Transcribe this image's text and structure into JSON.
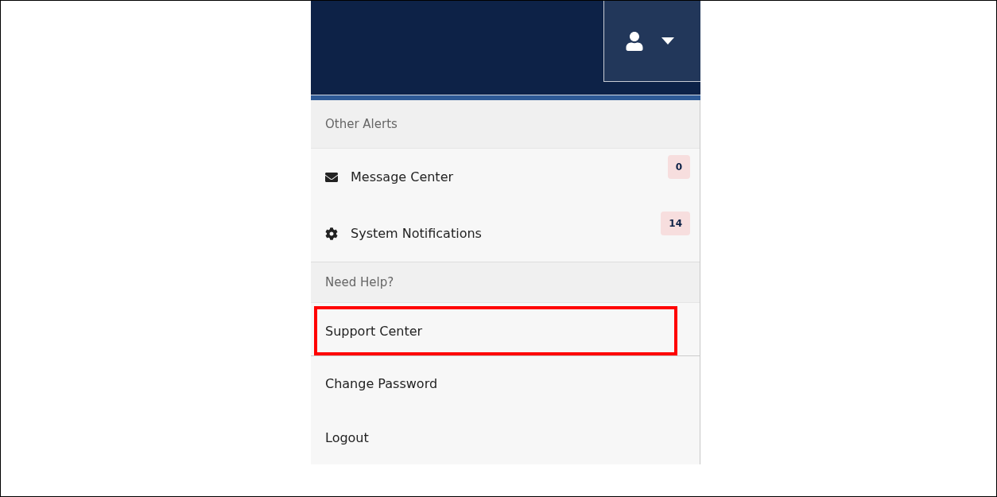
{
  "header": {
    "user_menu": {
      "expanded": true
    }
  },
  "menu": [
    {
      "kind": "heading",
      "label": "Other Alerts"
    },
    {
      "kind": "mail",
      "label": "Message Center",
      "badge": "0",
      "highlighted": false
    },
    {
      "kind": "settings",
      "label": "System Notifications",
      "badge": "14",
      "highlighted": false
    },
    {
      "kind": "heading",
      "label": "Need Help?"
    },
    {
      "kind": "item",
      "label": "Support Center",
      "highlighted": true
    },
    {
      "kind": "item",
      "label": "Change Password",
      "highlighted": false
    },
    {
      "kind": "item",
      "label": "Logout",
      "highlighted": false
    }
  ]
}
